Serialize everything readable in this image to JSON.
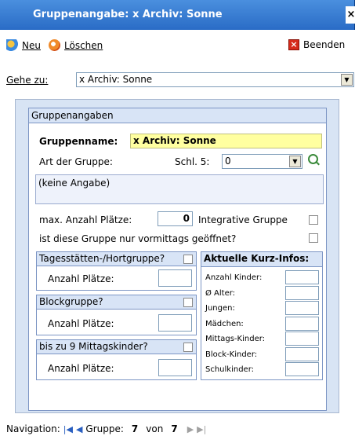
{
  "window": {
    "title": "Gruppenangabe: x Archiv: Sonne",
    "close_glyph": "×"
  },
  "toolbar": {
    "new_label": "Neu",
    "delete_label": "Löschen",
    "exit_label": "Beenden"
  },
  "goto": {
    "label": "Gehe zu:",
    "value": "x Archiv: Sonne"
  },
  "panel": {
    "header": "Gruppenangaben",
    "name_label": "Gruppenname:",
    "name_value": "x Archiv: Sonne",
    "art_label": "Art der Gruppe:",
    "schl_label": "Schl. 5:",
    "schl_value": "0",
    "description": "(keine Angabe)",
    "max_label": "max. Anzahl Plätze:",
    "max_value": "0",
    "integrative_label": "Integrative Gruppe",
    "vormittags_label": "ist diese Gruppe nur vormittags geöffnet?"
  },
  "sections": {
    "tages": {
      "title": "Tagesstätten-/Hortgruppe?",
      "field_label": "Anzahl Plätze:"
    },
    "block": {
      "title": "Blockgruppe?",
      "field_label": "Anzahl Plätze:"
    },
    "mittag": {
      "title": "bis zu 9 Mittagskinder?",
      "field_label": "Anzahl Plätze:"
    }
  },
  "infos": {
    "title": "Aktuelle Kurz-Infos:",
    "rows": [
      "Anzahl Kinder:",
      "Ø Alter:",
      "Jungen:",
      "Mädchen:",
      "Mittags-Kinder:",
      "Block-Kinder:",
      "Schulkinder:"
    ]
  },
  "navigation": {
    "label": "Navigation:",
    "group_label": "Gruppe:",
    "current": "7",
    "of_label": "von",
    "total": "7"
  },
  "icons": [
    "new-icon",
    "delete-icon",
    "exit-icon",
    "dropdown-icon",
    "zoom-icon",
    "first-icon",
    "prev-icon",
    "next-icon",
    "last-icon"
  ],
  "colors": {
    "titlebar": "#2a6cc6",
    "name_field_bg": "#ffffa0",
    "panel_bg": "#d8e4f4"
  }
}
